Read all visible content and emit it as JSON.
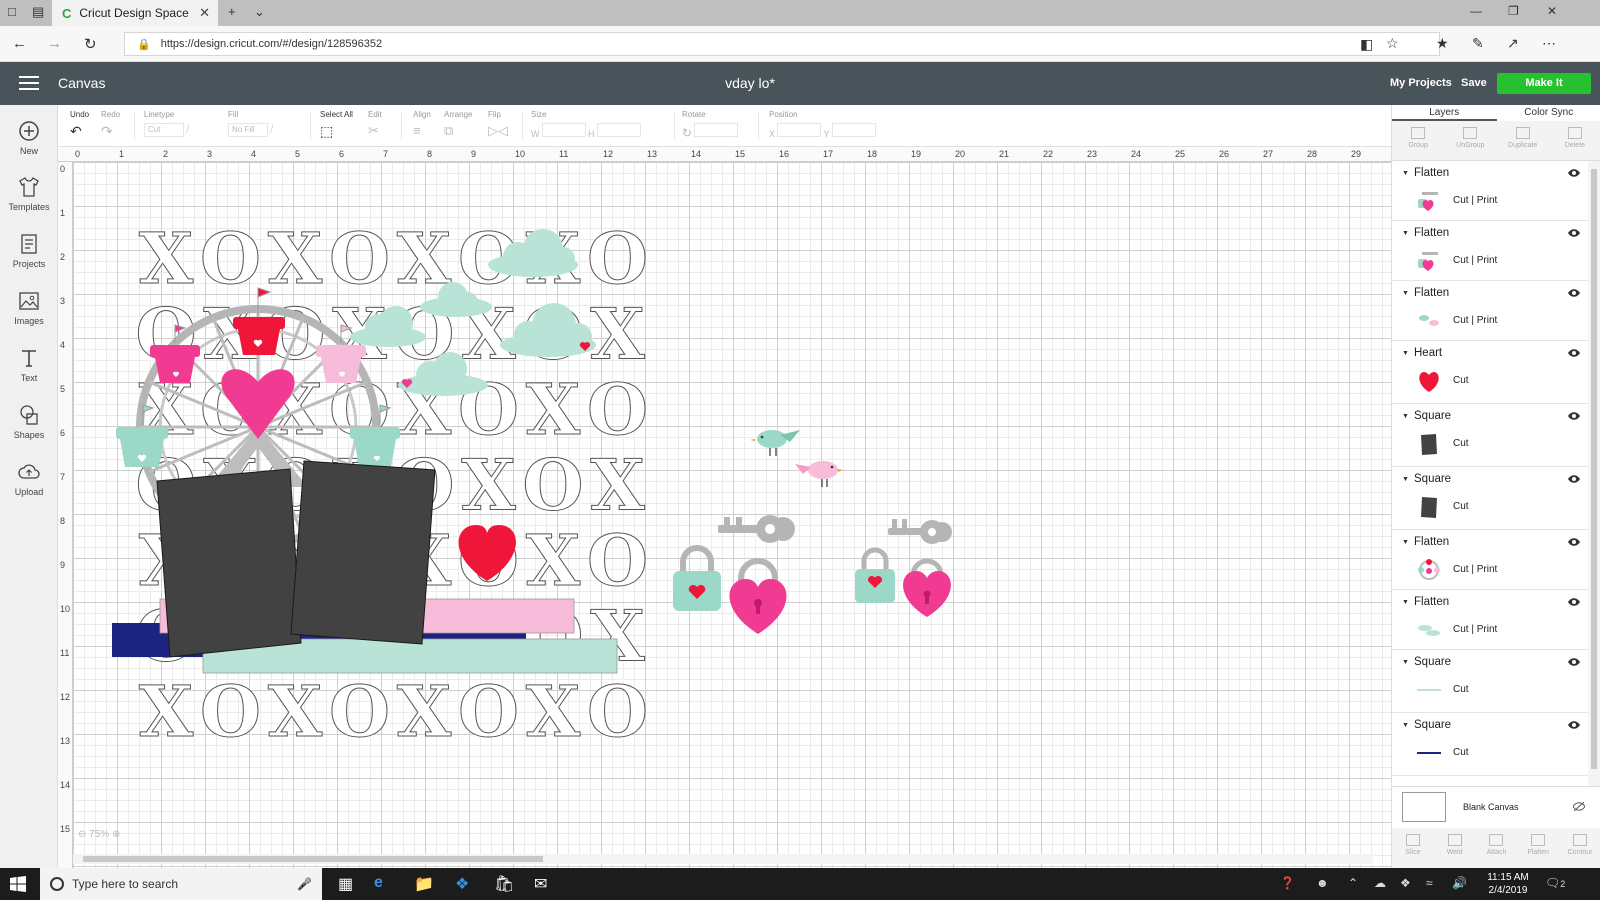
{
  "browser": {
    "tab_title": "Cricut Design Space",
    "tab_favicon": "C",
    "url": "https://design.cricut.com/#/design/128596352"
  },
  "header": {
    "app_title": "Canvas",
    "document_title": "vday lo*",
    "my_projects": "My Projects",
    "save": "Save",
    "make_it": "Make It"
  },
  "sidebar": {
    "items": [
      {
        "label": "New",
        "icon": "plus-circle-icon"
      },
      {
        "label": "Templates",
        "icon": "tshirt-icon"
      },
      {
        "label": "Projects",
        "icon": "projects-icon"
      },
      {
        "label": "Images",
        "icon": "image-icon"
      },
      {
        "label": "Text",
        "icon": "text-icon"
      },
      {
        "label": "Shapes",
        "icon": "shapes-icon"
      },
      {
        "label": "Upload",
        "icon": "upload-icon"
      }
    ]
  },
  "toolbar": {
    "undo": "Undo",
    "redo": "Redo",
    "linetype": "Linetype",
    "linetype_value": "Cut",
    "fill": "Fill",
    "fill_value": "No Fill",
    "select_all": "Select All",
    "edit": "Edit",
    "align": "Align",
    "arrange": "Arrange",
    "flip": "Flip",
    "size": "Size",
    "size_w": "W",
    "size_h": "H",
    "rotate": "Rotate",
    "position": "Position",
    "pos_x": "X",
    "pos_y": "Y"
  },
  "canvas": {
    "ruler_top": [
      "0",
      "1",
      "2",
      "3",
      "4",
      "5",
      "6",
      "7",
      "8",
      "9",
      "10",
      "11",
      "12",
      "13",
      "14",
      "15",
      "16",
      "17",
      "18",
      "19",
      "20",
      "21",
      "22",
      "23",
      "24",
      "25",
      "26",
      "27",
      "28",
      "29"
    ],
    "ruler_left": [
      "0",
      "1",
      "2",
      "3",
      "4",
      "5",
      "6",
      "7",
      "8",
      "9",
      "10",
      "11",
      "12",
      "13",
      "14",
      "15"
    ],
    "zoom": "75%",
    "xo_rows": [
      "XOXOXOXO",
      "OXOXOXOX",
      "XOXOXOXO",
      "OXOXOXOX",
      "XOXOXOXO",
      "OXOXOXOX",
      "XOXOXOXO"
    ]
  },
  "layers_panel": {
    "tabs": [
      "Layers",
      "Color Sync"
    ],
    "actions": [
      "Group",
      "UnGroup",
      "Duplicate",
      "Delete"
    ],
    "layers": [
      {
        "name": "Flatten",
        "ops": "Cut  |  Print",
        "thumb": "locks"
      },
      {
        "name": "Flatten",
        "ops": "Cut  |  Print",
        "thumb": "locks"
      },
      {
        "name": "Flatten",
        "ops": "Cut  |  Print",
        "thumb": "birds"
      },
      {
        "name": "Heart",
        "ops": "Cut",
        "thumb": "heart"
      },
      {
        "name": "Square",
        "ops": "Cut",
        "thumb": "dark-square"
      },
      {
        "name": "Square",
        "ops": "Cut",
        "thumb": "dark-square"
      },
      {
        "name": "Flatten",
        "ops": "Cut  |  Print",
        "thumb": "ferris"
      },
      {
        "name": "Flatten",
        "ops": "Cut  |  Print",
        "thumb": "clouds"
      },
      {
        "name": "Square",
        "ops": "Cut",
        "thumb": "mint-line"
      },
      {
        "name": "Square",
        "ops": "Cut",
        "thumb": "navy-line"
      }
    ],
    "blank_canvas": "Blank Canvas",
    "bottom_actions": [
      "Slice",
      "Weld",
      "Attach",
      "Flatten",
      "Contour"
    ]
  },
  "taskbar": {
    "search_placeholder": "Type here to search",
    "time": "11:15 AM",
    "date": "2/4/2019",
    "notifications": "2"
  },
  "colors": {
    "header_bg": "#49535a",
    "make_it": "#25c12f",
    "mint": "#b9e3d7",
    "pink": "#f13b93",
    "light_pink": "#f7bcd9",
    "red": "#f0163a",
    "navy": "#1c2380",
    "dark_square": "#424242"
  }
}
